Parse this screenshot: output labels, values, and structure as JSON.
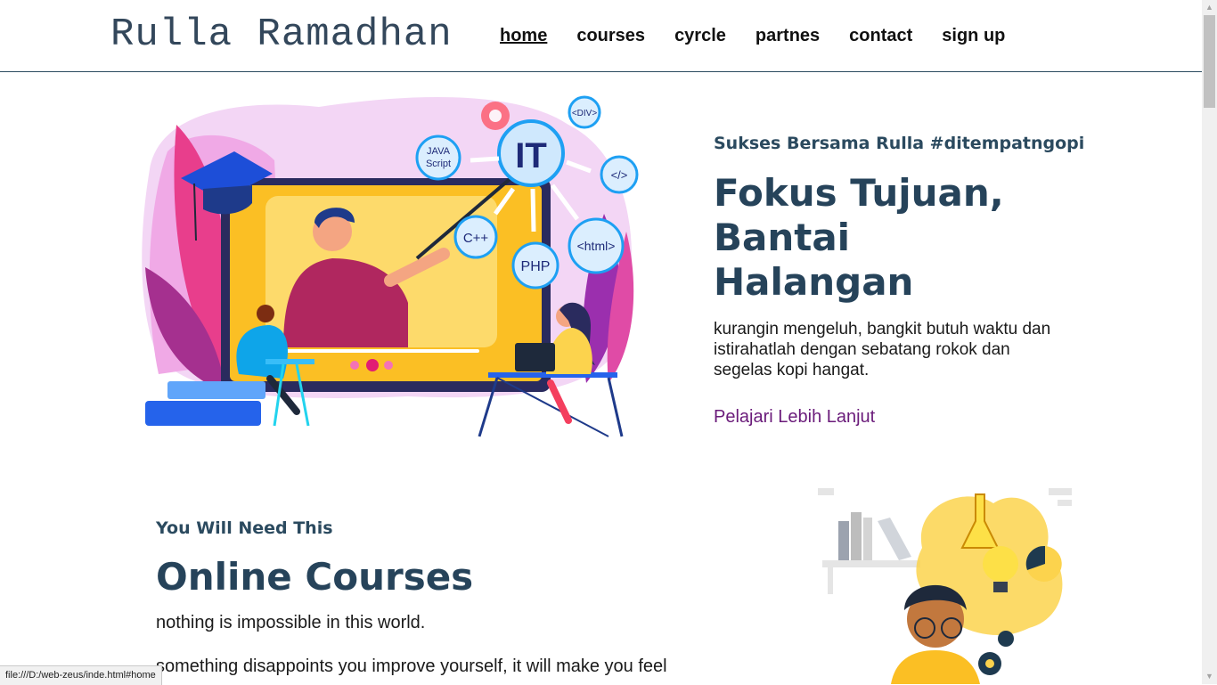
{
  "header": {
    "logo": "Rulla Ramadhan",
    "nav": [
      "home",
      "courses",
      "cyrcle",
      "partnes",
      "contact",
      "sign up"
    ],
    "active_nav": "home"
  },
  "hero": {
    "eyebrow": "Sukses Bersama Rulla #ditempatngopi",
    "title": "Fokus Tujuan, Bantai Halangan",
    "description": "kurangin mengeluh, bangkit butuh waktu dan istirahatlah dengan sebatang rokok dan segelas kopi hangat.",
    "link": "Pelajari Lebih Lanjut",
    "illustration_labels": [
      "IT",
      "<DIV>",
      "JAVA",
      "Script",
      "</>",
      "C++",
      "PHP",
      "<html>"
    ]
  },
  "courses": {
    "eyebrow": "You Will Need This",
    "title": "Online Courses",
    "description": "nothing is impossible in this world.",
    "description2": "something disappoints you improve yourself, it will make you feel"
  },
  "status_bar": "file:///D:/web-zeus/inde.html#home",
  "colors": {
    "heading": "#26435a",
    "link": "#6a1b7a",
    "accent_yellow": "#fcd34d",
    "accent_pink": "#e11d74"
  }
}
